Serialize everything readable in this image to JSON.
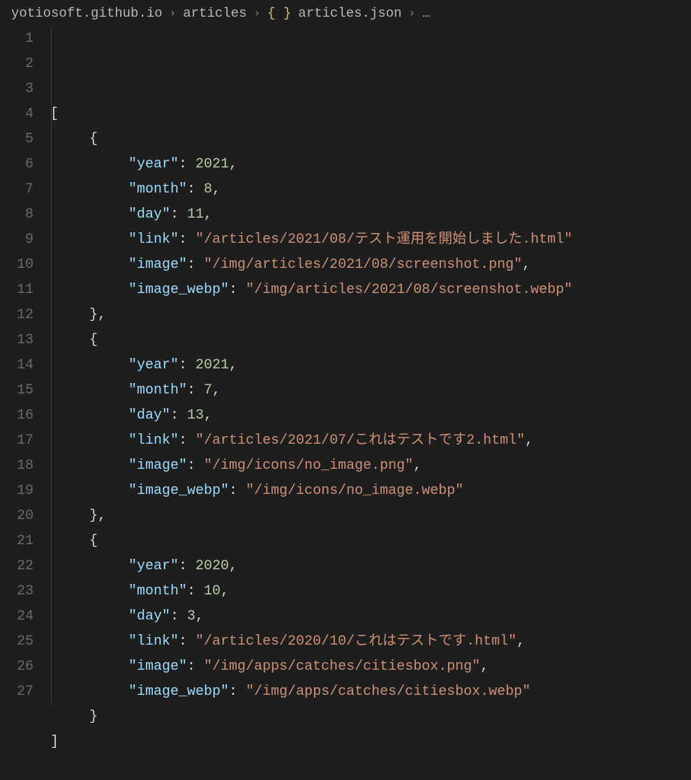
{
  "breadcrumb": {
    "segments": [
      "yotiosoft.github.io",
      "articles",
      "articles.json"
    ],
    "file_icon": "{ }",
    "ellipsis": "…"
  },
  "editor": {
    "line_count": 27,
    "content": [
      {
        "indent": 0,
        "tokens": [
          {
            "t": "punc",
            "v": "["
          }
        ]
      },
      {
        "indent": 1,
        "tokens": [
          {
            "t": "punc",
            "v": "{"
          }
        ]
      },
      {
        "indent": 2,
        "tokens": [
          {
            "t": "key",
            "v": "\"year\""
          },
          {
            "t": "colon",
            "v": ": "
          },
          {
            "t": "num",
            "v": "2021"
          },
          {
            "t": "punc",
            "v": ","
          }
        ]
      },
      {
        "indent": 2,
        "tokens": [
          {
            "t": "key",
            "v": "\"month\""
          },
          {
            "t": "colon",
            "v": ": "
          },
          {
            "t": "num",
            "v": "8"
          },
          {
            "t": "punc",
            "v": ","
          }
        ]
      },
      {
        "indent": 2,
        "tokens": [
          {
            "t": "key",
            "v": "\"day\""
          },
          {
            "t": "colon",
            "v": ": "
          },
          {
            "t": "num",
            "v": "11"
          },
          {
            "t": "punc",
            "v": ","
          }
        ]
      },
      {
        "indent": 2,
        "tokens": [
          {
            "t": "key",
            "v": "\"link\""
          },
          {
            "t": "colon",
            "v": ": "
          },
          {
            "t": "str",
            "v": "\"/articles/2021/08/テスト運用を開始しました.html\""
          }
        ]
      },
      {
        "indent": 2,
        "tokens": [
          {
            "t": "key",
            "v": "\"image\""
          },
          {
            "t": "colon",
            "v": ": "
          },
          {
            "t": "str",
            "v": "\"/img/articles/2021/08/screenshot.png\""
          },
          {
            "t": "punc",
            "v": ","
          }
        ]
      },
      {
        "indent": 2,
        "tokens": [
          {
            "t": "key",
            "v": "\"image_webp\""
          },
          {
            "t": "colon",
            "v": ": "
          },
          {
            "t": "str",
            "v": "\"/img/articles/2021/08/screenshot.webp\""
          }
        ]
      },
      {
        "indent": 1,
        "tokens": [
          {
            "t": "punc",
            "v": "},"
          }
        ]
      },
      {
        "indent": 1,
        "tokens": [
          {
            "t": "punc",
            "v": "{"
          }
        ]
      },
      {
        "indent": 2,
        "tokens": [
          {
            "t": "key",
            "v": "\"year\""
          },
          {
            "t": "colon",
            "v": ": "
          },
          {
            "t": "num",
            "v": "2021"
          },
          {
            "t": "punc",
            "v": ","
          }
        ]
      },
      {
        "indent": 2,
        "tokens": [
          {
            "t": "key",
            "v": "\"month\""
          },
          {
            "t": "colon",
            "v": ": "
          },
          {
            "t": "num",
            "v": "7"
          },
          {
            "t": "punc",
            "v": ","
          }
        ]
      },
      {
        "indent": 2,
        "tokens": [
          {
            "t": "key",
            "v": "\"day\""
          },
          {
            "t": "colon",
            "v": ": "
          },
          {
            "t": "num",
            "v": "13"
          },
          {
            "t": "punc",
            "v": ","
          }
        ]
      },
      {
        "indent": 2,
        "tokens": [
          {
            "t": "key",
            "v": "\"link\""
          },
          {
            "t": "colon",
            "v": ": "
          },
          {
            "t": "str",
            "v": "\"/articles/2021/07/これはテストです2.html\""
          },
          {
            "t": "punc",
            "v": ","
          }
        ]
      },
      {
        "indent": 2,
        "tokens": [
          {
            "t": "key",
            "v": "\"image\""
          },
          {
            "t": "colon",
            "v": ": "
          },
          {
            "t": "str",
            "v": "\"/img/icons/no_image.png\""
          },
          {
            "t": "punc",
            "v": ","
          }
        ]
      },
      {
        "indent": 2,
        "tokens": [
          {
            "t": "key",
            "v": "\"image_webp\""
          },
          {
            "t": "colon",
            "v": ": "
          },
          {
            "t": "str",
            "v": "\"/img/icons/no_image.webp\""
          }
        ]
      },
      {
        "indent": 1,
        "tokens": [
          {
            "t": "punc",
            "v": "},"
          }
        ]
      },
      {
        "indent": 1,
        "tokens": [
          {
            "t": "punc",
            "v": "{"
          }
        ]
      },
      {
        "indent": 2,
        "tokens": [
          {
            "t": "key",
            "v": "\"year\""
          },
          {
            "t": "colon",
            "v": ": "
          },
          {
            "t": "num",
            "v": "2020"
          },
          {
            "t": "punc",
            "v": ","
          }
        ]
      },
      {
        "indent": 2,
        "tokens": [
          {
            "t": "key",
            "v": "\"month\""
          },
          {
            "t": "colon",
            "v": ": "
          },
          {
            "t": "num",
            "v": "10"
          },
          {
            "t": "punc",
            "v": ","
          }
        ]
      },
      {
        "indent": 2,
        "tokens": [
          {
            "t": "key",
            "v": "\"day\""
          },
          {
            "t": "colon",
            "v": ": "
          },
          {
            "t": "num",
            "v": "3"
          },
          {
            "t": "punc",
            "v": ","
          }
        ]
      },
      {
        "indent": 2,
        "tokens": [
          {
            "t": "key",
            "v": "\"link\""
          },
          {
            "t": "colon",
            "v": ": "
          },
          {
            "t": "str",
            "v": "\"/articles/2020/10/これはテストです.html\""
          },
          {
            "t": "punc",
            "v": ","
          }
        ]
      },
      {
        "indent": 2,
        "tokens": [
          {
            "t": "key",
            "v": "\"image\""
          },
          {
            "t": "colon",
            "v": ": "
          },
          {
            "t": "str",
            "v": "\"/img/apps/catches/citiesbox.png\""
          },
          {
            "t": "punc",
            "v": ","
          }
        ]
      },
      {
        "indent": 2,
        "tokens": [
          {
            "t": "key",
            "v": "\"image_webp\""
          },
          {
            "t": "colon",
            "v": ": "
          },
          {
            "t": "str",
            "v": "\"/img/apps/catches/citiesbox.webp\""
          }
        ]
      },
      {
        "indent": 1,
        "tokens": [
          {
            "t": "punc",
            "v": "}"
          }
        ]
      },
      {
        "indent": 0,
        "tokens": [
          {
            "t": "punc",
            "v": "]"
          }
        ]
      },
      {
        "indent": 0,
        "tokens": []
      }
    ]
  }
}
